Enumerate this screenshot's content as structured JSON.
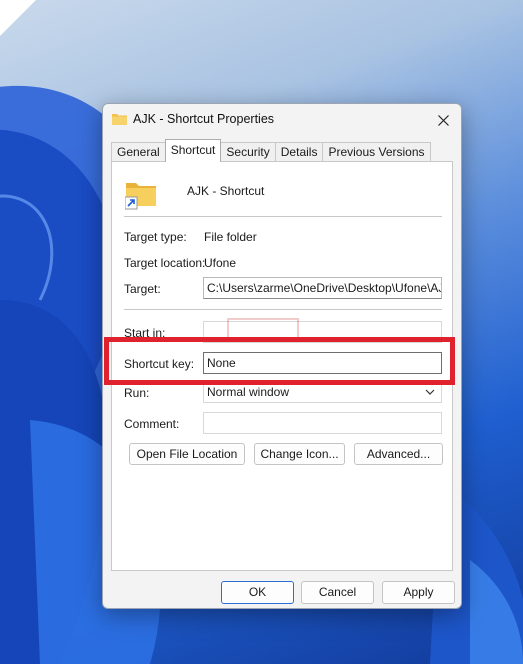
{
  "dialog": {
    "title": "AJK - Shortcut Properties",
    "tabs": [
      {
        "label": "General",
        "active": false
      },
      {
        "label": "Shortcut",
        "active": true
      },
      {
        "label": "Security",
        "active": false
      },
      {
        "label": "Details",
        "active": false
      },
      {
        "label": "Previous Versions",
        "active": false
      }
    ],
    "shortcut_name": "AJK - Shortcut",
    "target_type_label": "Target type:",
    "target_type_value": "File folder",
    "target_location_label": "Target location:",
    "target_location_value": "Ufone",
    "target_label": "Target:",
    "target_value": "C:\\Users\\zarme\\OneDrive\\Desktop\\Ufone\\AJK",
    "start_in_label": "Start in:",
    "start_in_value": "",
    "shortcut_key_label": "Shortcut key:",
    "shortcut_key_value": "None",
    "run_label": "Run:",
    "run_value": "Normal window",
    "comment_label": "Comment:",
    "comment_value": "",
    "buttons": {
      "open_file_location": "Open File Location",
      "change_icon": "Change Icon...",
      "advanced": "Advanced..."
    },
    "footer": {
      "ok": "OK",
      "cancel": "Cancel",
      "apply": "Apply"
    }
  },
  "colors": {
    "highlight": "#e0222e",
    "folder": "#f2c14e",
    "wallpaper_accent": "#1f5fd0"
  },
  "icons": [
    "folder-icon",
    "shortcut-arrow-icon",
    "close-icon",
    "chevron-down-icon"
  ]
}
